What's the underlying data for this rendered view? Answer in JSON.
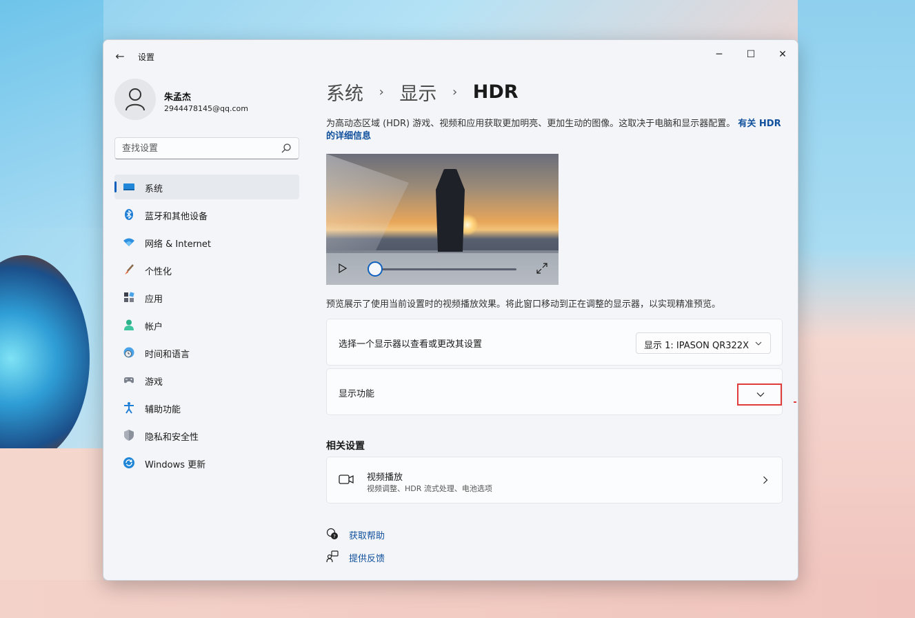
{
  "window": {
    "app_title": "设置",
    "controls": {
      "minimize": "─",
      "maximize": "☐",
      "close": "✕"
    }
  },
  "profile": {
    "name": "朱孟杰",
    "email": "2944478145@qq.com"
  },
  "search": {
    "placeholder": "查找设置"
  },
  "sidebar": {
    "items": [
      {
        "label": "系统",
        "icon": "monitor-icon",
        "active": true
      },
      {
        "label": "蓝牙和其他设备",
        "icon": "bluetooth-icon"
      },
      {
        "label": "网络 & Internet",
        "icon": "wifi-icon"
      },
      {
        "label": "个性化",
        "icon": "brush-icon"
      },
      {
        "label": "应用",
        "icon": "apps-icon"
      },
      {
        "label": "帐户",
        "icon": "account-icon"
      },
      {
        "label": "时间和语言",
        "icon": "clock-globe-icon"
      },
      {
        "label": "游戏",
        "icon": "gamepad-icon"
      },
      {
        "label": "辅助功能",
        "icon": "accessibility-icon"
      },
      {
        "label": "隐私和安全性",
        "icon": "shield-icon"
      },
      {
        "label": "Windows 更新",
        "icon": "update-icon"
      }
    ]
  },
  "breadcrumb": {
    "root": "系统",
    "parent": "显示",
    "current": "HDR",
    "separator": "›"
  },
  "description": {
    "text": "为高动态区域 (HDR) 游戏、视频和应用获取更加明亮、更加生动的图像。这取决于电脑和显示器配置。",
    "link": "有关 HDR 的详细信息"
  },
  "video": {
    "progress": 0
  },
  "preview_note": "预览展示了使用当前设置时的视频播放效果。将此窗口移动到正在调整的显示器，以实现精准预览。",
  "monitor_select": {
    "label": "选择一个显示器以查看或更改其设置",
    "value": "显示 1: IPASON QR322X"
  },
  "display_features": {
    "label": "显示功能"
  },
  "related": {
    "title": "相关设置",
    "video_playback": {
      "title": "视频播放",
      "subtitle": "视频调整、HDR 流式处理、电池选项"
    }
  },
  "help": {
    "get_help": "获取帮助",
    "feedback": "提供反馈"
  },
  "colors": {
    "accent": "#0f5fbd",
    "link": "#0f4f9c",
    "highlight": "#e03a3a"
  }
}
